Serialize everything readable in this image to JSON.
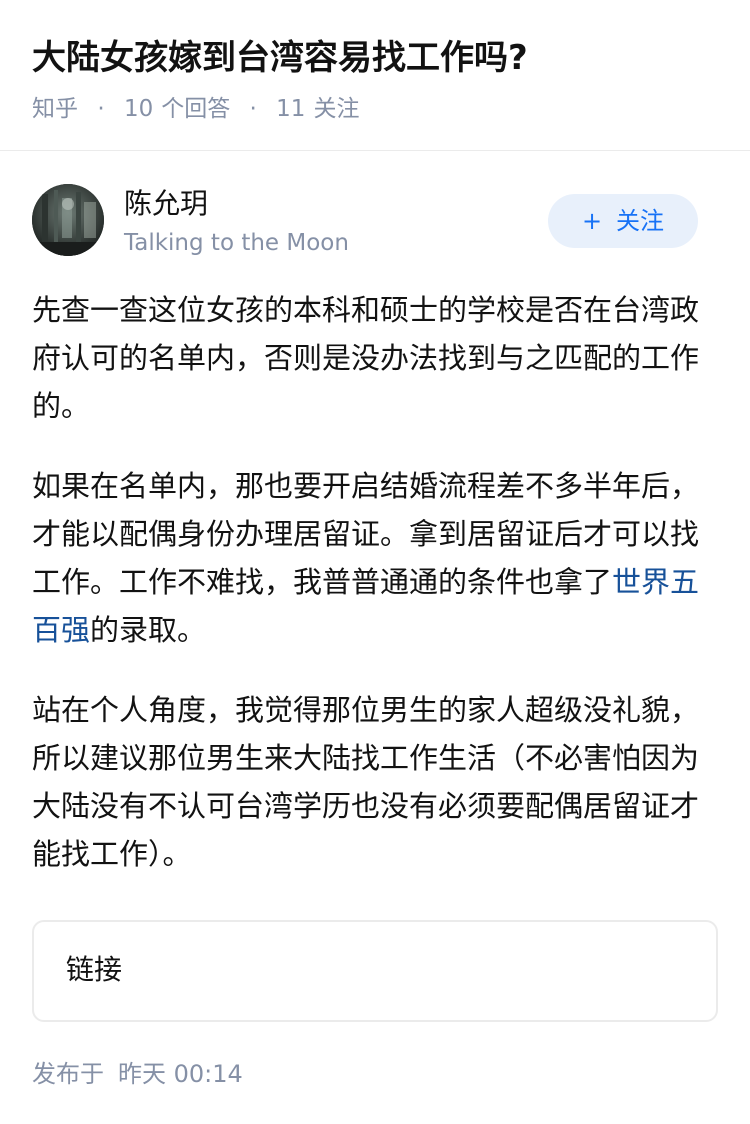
{
  "question": {
    "title": "大陆女孩嫁到台湾容易找工作吗?",
    "source": "知乎",
    "separator": "·",
    "answer_count": "10",
    "answer_label": "个回答",
    "follow_count": "11",
    "follow_label": "关注"
  },
  "author": {
    "name": "陈允玥",
    "bio": "Talking to the Moon",
    "follow_button": {
      "icon": "+",
      "label": "关注"
    }
  },
  "answer": {
    "paragraph1": "先查一查这位女孩的本科和硕士的学校是否在台湾政府认可的名单内，否则是没办法找到与之匹配的工作的。",
    "paragraph2_before": "如果在名单内，那也要开启结婚流程差不多半年后，才能以配偶身份办理居留证。拿到居留证后才可以找工作。工作不难找，我普普通通的条件也拿了",
    "paragraph2_link": "世界五百强",
    "paragraph2_after": "的录取。",
    "paragraph3": "站在个人角度，我觉得那位男生的家人超级没礼貌，所以建议那位男生来大陆找工作生活（不必害怕因为大陆没有不认可台湾学历也没有必须要配偶居留证才能找工作）。"
  },
  "link_card": {
    "label": "链接"
  },
  "footer": {
    "published_label": "发布于",
    "published_time": "昨天 00:14"
  },
  "colors": {
    "text": "#121212",
    "meta": "#8590a6",
    "link": "#175199",
    "accent": "#1772f6",
    "follow_bg": "#e8f0fb",
    "border": "#ebebeb"
  }
}
